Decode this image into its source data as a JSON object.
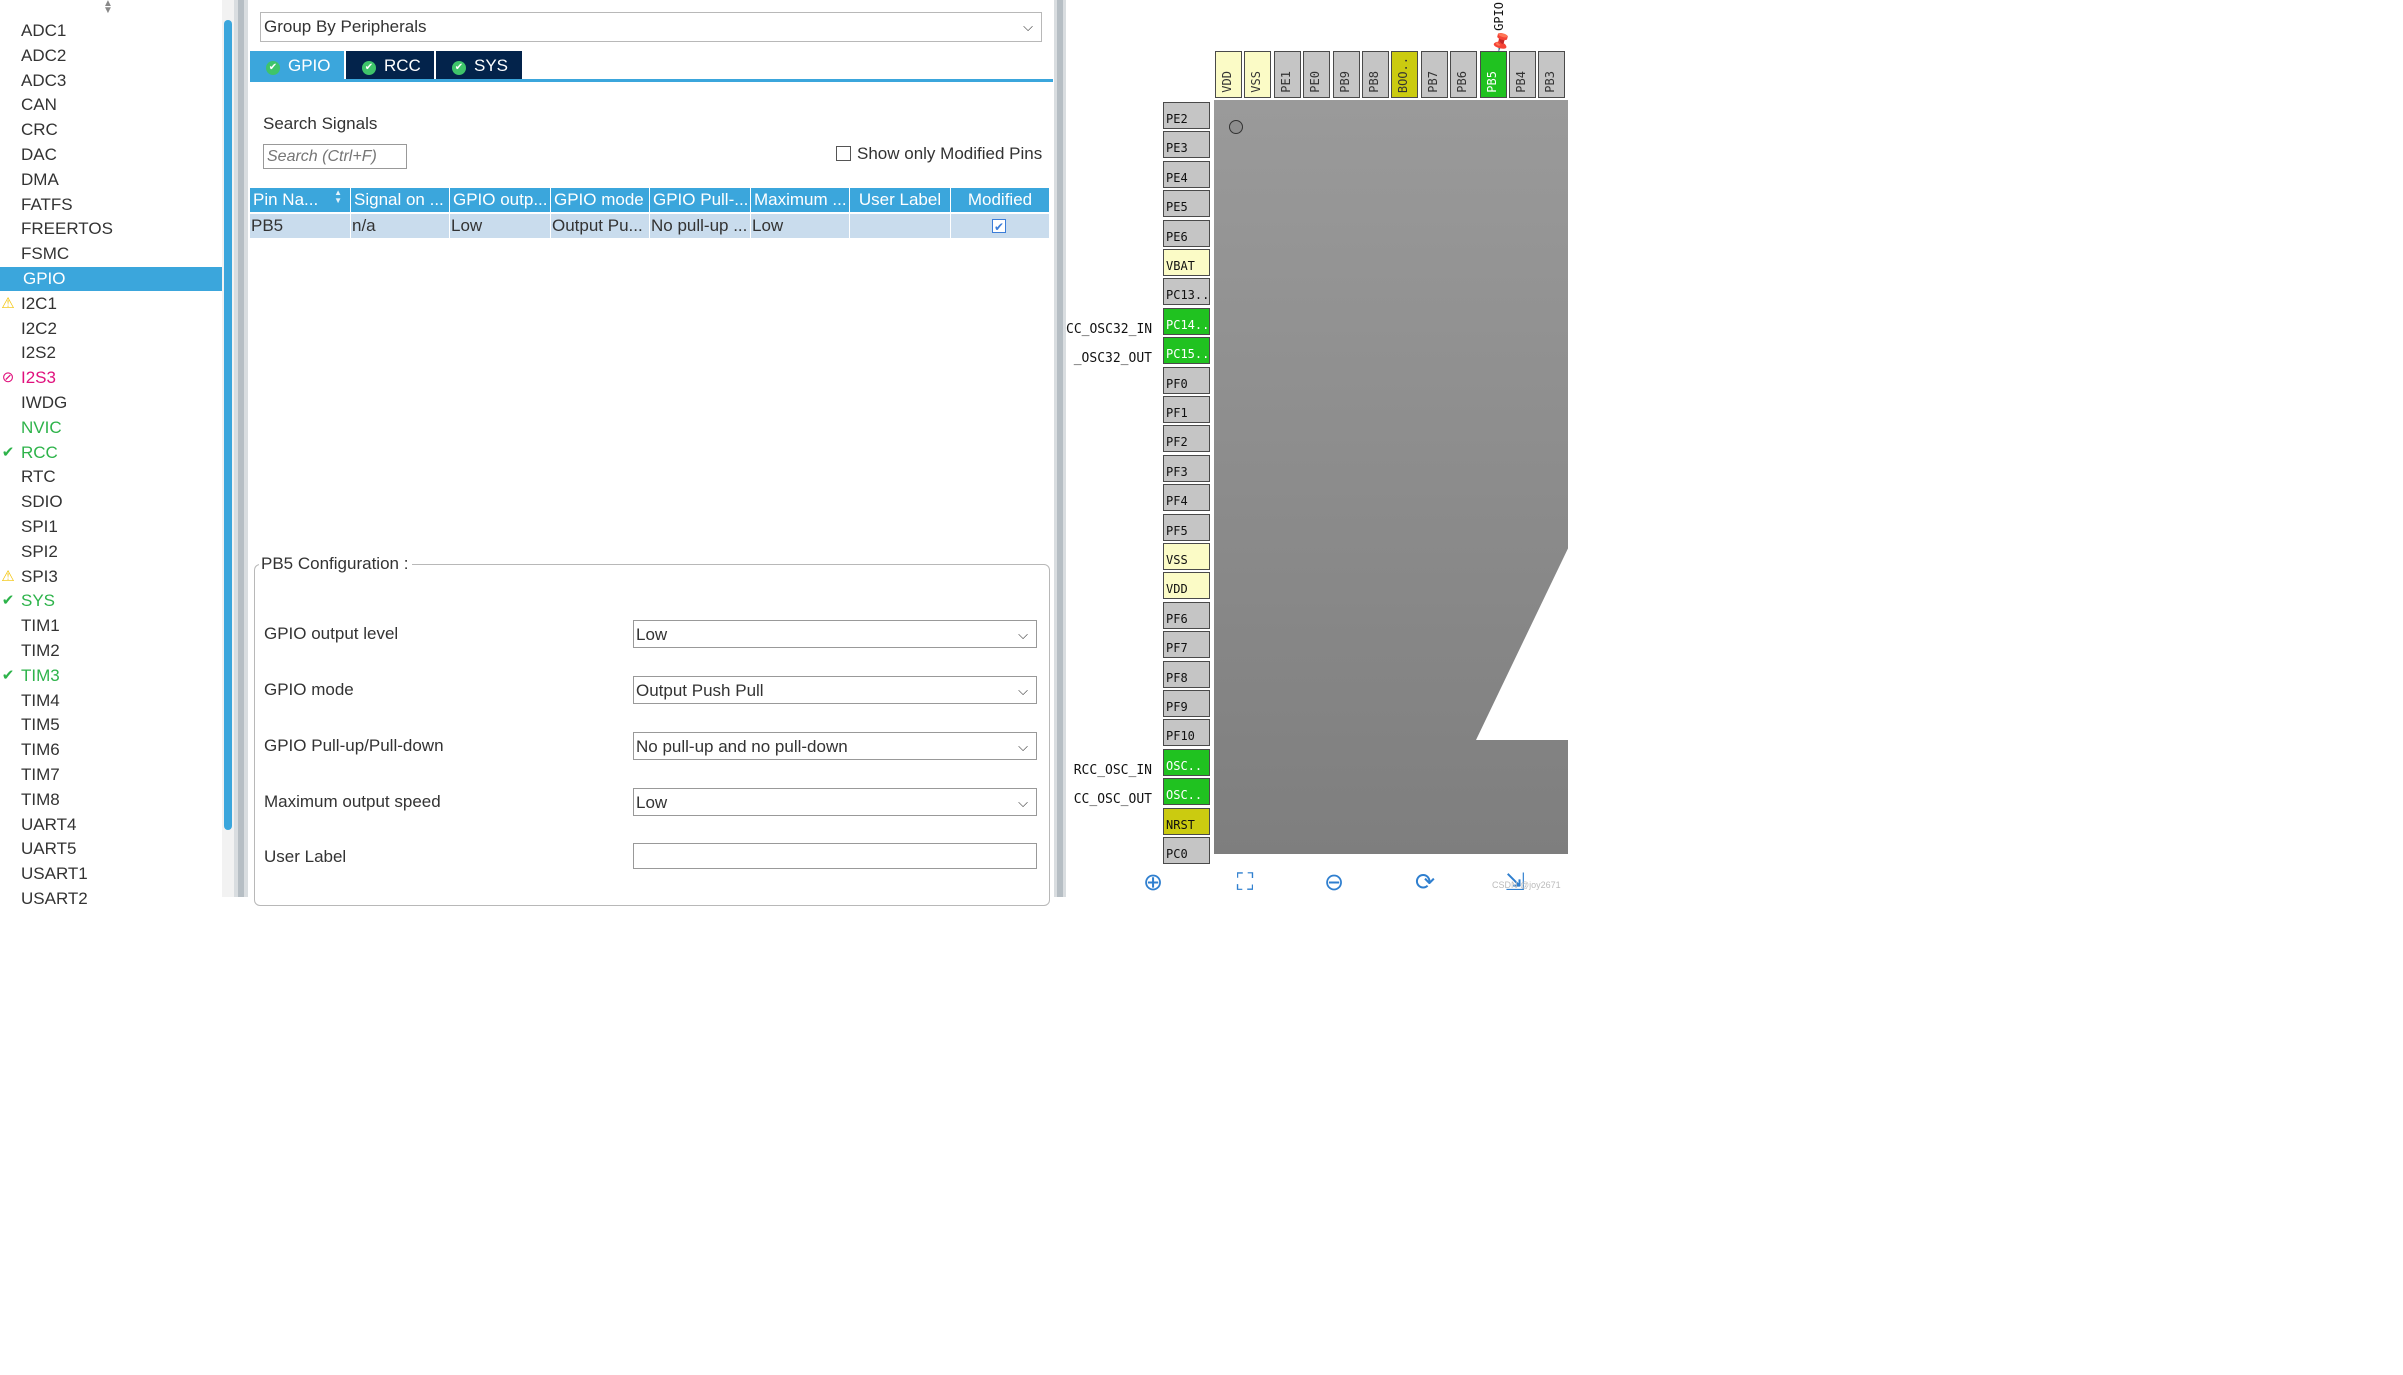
{
  "peripherals": [
    {
      "label": "ADC1",
      "status": "none"
    },
    {
      "label": "ADC2",
      "status": "none"
    },
    {
      "label": "ADC3",
      "status": "none"
    },
    {
      "label": "CAN",
      "status": "none"
    },
    {
      "label": "CRC",
      "status": "none"
    },
    {
      "label": "DAC",
      "status": "none"
    },
    {
      "label": "DMA",
      "status": "none"
    },
    {
      "label": "FATFS",
      "status": "none"
    },
    {
      "label": "FREERTOS",
      "status": "none"
    },
    {
      "label": "FSMC",
      "status": "none"
    },
    {
      "label": "GPIO",
      "status": "selected"
    },
    {
      "label": "I2C1",
      "status": "warning"
    },
    {
      "label": "I2C2",
      "status": "none"
    },
    {
      "label": "I2S2",
      "status": "none"
    },
    {
      "label": "I2S3",
      "status": "blocked"
    },
    {
      "label": "IWDG",
      "status": "none"
    },
    {
      "label": "NVIC",
      "status": "green"
    },
    {
      "label": "RCC",
      "status": "ok"
    },
    {
      "label": "RTC",
      "status": "none"
    },
    {
      "label": "SDIO",
      "status": "none"
    },
    {
      "label": "SPI1",
      "status": "none"
    },
    {
      "label": "SPI2",
      "status": "none"
    },
    {
      "label": "SPI3",
      "status": "warning"
    },
    {
      "label": "SYS",
      "status": "ok"
    },
    {
      "label": "TIM1",
      "status": "none"
    },
    {
      "label": "TIM2",
      "status": "none"
    },
    {
      "label": "TIM3",
      "status": "ok"
    },
    {
      "label": "TIM4",
      "status": "none"
    },
    {
      "label": "TIM5",
      "status": "none"
    },
    {
      "label": "TIM6",
      "status": "none"
    },
    {
      "label": "TIM7",
      "status": "none"
    },
    {
      "label": "TIM8",
      "status": "none"
    },
    {
      "label": "UART4",
      "status": "none"
    },
    {
      "label": "UART5",
      "status": "none"
    },
    {
      "label": "USART1",
      "status": "none"
    },
    {
      "label": "USART2",
      "status": "none"
    }
  ],
  "group_by": {
    "value": "Group By Peripherals"
  },
  "tabs": [
    {
      "label": "GPIO",
      "active": true
    },
    {
      "label": "RCC",
      "active": false
    },
    {
      "label": "SYS",
      "active": false
    }
  ],
  "search": {
    "label": "Search Signals",
    "placeholder": "Search (Ctrl+F)"
  },
  "show_modified": {
    "label": "Show only Modified Pins",
    "checked": false
  },
  "table": {
    "headers": [
      "Pin Na...",
      "Signal on ...",
      "GPIO outp...",
      "GPIO mode",
      "GPIO Pull-...",
      "Maximum ...",
      "User Label",
      "Modified"
    ],
    "rows": [
      {
        "pin": "PB5",
        "signal": "n/a",
        "output": "Low",
        "mode": "Output Pu...",
        "pull": "No pull-up ...",
        "speed": "Low",
        "label": "",
        "modified": true
      }
    ]
  },
  "config": {
    "title": "PB5 Configuration :",
    "fields": [
      {
        "label": "GPIO output level",
        "value": "Low"
      },
      {
        "label": "GPIO mode",
        "value": "Output Push Pull"
      },
      {
        "label": "GPIO Pull-up/Pull-down",
        "value": "No pull-up and no pull-down"
      },
      {
        "label": "Maximum output speed",
        "value": "Low"
      },
      {
        "label": "User Label",
        "value": ""
      }
    ]
  },
  "pinout": {
    "top_pins": [
      {
        "label": "VDD",
        "color": "yellow"
      },
      {
        "label": "VSS",
        "color": "yellow"
      },
      {
        "label": "PE1",
        "color": "gray"
      },
      {
        "label": "PE0",
        "color": "gray"
      },
      {
        "label": "PB9",
        "color": "gray"
      },
      {
        "label": "PB8",
        "color": "gray"
      },
      {
        "label": "BOO..",
        "color": "olive"
      },
      {
        "label": "PB7",
        "color": "gray"
      },
      {
        "label": "PB6",
        "color": "gray"
      },
      {
        "label": "PB5",
        "color": "green"
      },
      {
        "label": "PB4",
        "color": "gray"
      },
      {
        "label": "PB3",
        "color": "gray"
      }
    ],
    "left_pins": [
      {
        "label": "PE2",
        "color": "gray"
      },
      {
        "label": "PE3",
        "color": "gray"
      },
      {
        "label": "PE4",
        "color": "gray"
      },
      {
        "label": "PE5",
        "color": "gray"
      },
      {
        "label": "PE6",
        "color": "gray"
      },
      {
        "label": "VBAT",
        "color": "yellow"
      },
      {
        "label": "PC13..",
        "color": "gray"
      },
      {
        "label": "PC14..",
        "color": "green"
      },
      {
        "label": "PC15..",
        "color": "green"
      },
      {
        "label": "PF0",
        "color": "gray"
      },
      {
        "label": "PF1",
        "color": "gray"
      },
      {
        "label": "PF2",
        "color": "gray"
      },
      {
        "label": "PF3",
        "color": "gray"
      },
      {
        "label": "PF4",
        "color": "gray"
      },
      {
        "label": "PF5",
        "color": "gray"
      },
      {
        "label": "VSS",
        "color": "yellow"
      },
      {
        "label": "VDD",
        "color": "yellow"
      },
      {
        "label": "PF6",
        "color": "gray"
      },
      {
        "label": "PF7",
        "color": "gray"
      },
      {
        "label": "PF8",
        "color": "gray"
      },
      {
        "label": "PF9",
        "color": "gray"
      },
      {
        "label": "PF10",
        "color": "gray"
      },
      {
        "label": "OSC..",
        "color": "green"
      },
      {
        "label": "OSC..",
        "color": "green"
      },
      {
        "label": "NRST",
        "color": "olive"
      },
      {
        "label": "PC0",
        "color": "gray"
      }
    ],
    "signals": [
      {
        "pin_index": 7,
        "text": "CC_OSC32_IN"
      },
      {
        "pin_index": 8,
        "text": "_OSC32_OUT"
      },
      {
        "pin_index": 22,
        "text": "RCC_OSC_IN"
      },
      {
        "pin_index": 23,
        "text": "CC_OSC_OUT"
      }
    ],
    "pb5_signal": "GPIO",
    "watermark": "CSDN @joy2671"
  },
  "colors": {
    "accent": "#3ba6dc",
    "tab_dark": "#03234b",
    "pin_green": "#20c220",
    "pin_yellow": "#fbfbc6",
    "pin_olive": "#cbcb10",
    "chip": "#8e8e8e"
  }
}
